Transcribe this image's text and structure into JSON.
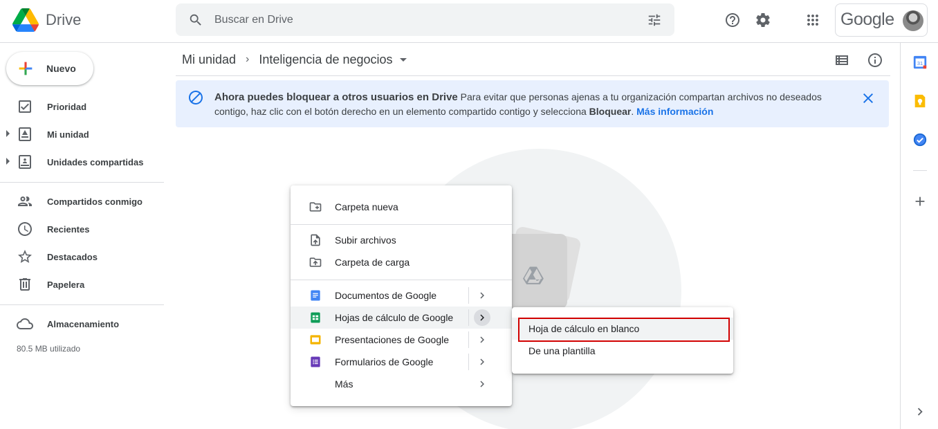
{
  "app": {
    "name": "Drive"
  },
  "search": {
    "placeholder": "Buscar en Drive"
  },
  "account": {
    "label": "Google"
  },
  "sidebar": {
    "new_label": "Nuevo",
    "items": [
      {
        "label": "Prioridad",
        "icon": "priority-icon"
      },
      {
        "label": "Mi unidad",
        "icon": "my-drive-icon"
      },
      {
        "label": "Unidades compartidas",
        "icon": "shared-drives-icon"
      },
      {
        "label": "Compartidos conmigo",
        "icon": "shared-with-me-icon"
      },
      {
        "label": "Recientes",
        "icon": "clock-icon"
      },
      {
        "label": "Destacados",
        "icon": "star-icon"
      },
      {
        "label": "Papelera",
        "icon": "trash-icon"
      },
      {
        "label": "Almacenamiento",
        "icon": "cloud-icon"
      }
    ],
    "storage_used": "80.5 MB utilizado"
  },
  "breadcrumb": {
    "root": "Mi unidad",
    "current": "Inteligencia de negocios"
  },
  "banner": {
    "title": "Ahora puedes bloquear a otros usuarios en Drive",
    "body_1": " Para evitar que personas ajenas a tu organización compartan archivos no deseados contigo, haz clic con el botón derecho en un elemento compartido contigo y selecciona ",
    "body_bold": "Bloquear",
    "body_2": ". ",
    "link": "Más información"
  },
  "menu": {
    "items": [
      {
        "label": "Carpeta nueva",
        "icon": "new-folder-icon"
      },
      {
        "label": "Subir archivos",
        "icon": "file-upload-icon"
      },
      {
        "label": "Carpeta de carga",
        "icon": "folder-upload-icon"
      },
      {
        "label": "Documentos de Google",
        "icon": "google-docs-icon",
        "color": "#4285f4"
      },
      {
        "label": "Hojas de cálculo de Google",
        "icon": "google-sheets-icon",
        "color": "#0f9d58"
      },
      {
        "label": "Presentaciones de Google",
        "icon": "google-slides-icon",
        "color": "#f4b400"
      },
      {
        "label": "Formularios de Google",
        "icon": "google-forms-icon",
        "color": "#673ab7"
      },
      {
        "label": "Más",
        "icon": ""
      }
    ]
  },
  "submenu": {
    "items": [
      {
        "label": "Hoja de cálculo en blanco"
      },
      {
        "label": "De una plantilla"
      }
    ]
  },
  "rail": {
    "calendar_day": "31"
  }
}
